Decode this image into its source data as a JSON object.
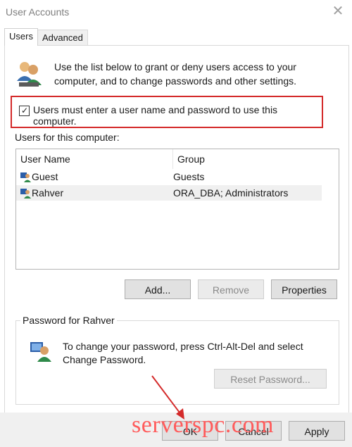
{
  "window": {
    "title": "User Accounts"
  },
  "tabs": [
    {
      "label": "Users",
      "active": true
    },
    {
      "label": "Advanced",
      "active": false
    }
  ],
  "intro": {
    "text": "Use the list below to grant or deny users access to your computer, and to change passwords and other settings.",
    "icon": "users-icon"
  },
  "require_login": {
    "label": "Users must enter a user name and password to use this computer.",
    "checked": true
  },
  "users_section": {
    "label": "Users for this computer:",
    "columns": [
      "User Name",
      "Group"
    ],
    "rows": [
      {
        "name": "Guest",
        "group": "Guests",
        "selected": false
      },
      {
        "name": "Rahver",
        "group": "ORA_DBA; Administrators",
        "selected": true
      }
    ]
  },
  "buttons": {
    "add": "Add...",
    "remove": "Remove",
    "properties": "Properties"
  },
  "password_group": {
    "title": "Password for Rahver",
    "text": "To change your password, press Ctrl-Alt-Del and select Change Password.",
    "reset_label": "Reset Password..."
  },
  "footer": {
    "ok": "OK",
    "cancel": "Cancel",
    "apply": "Apply"
  },
  "watermark": "serverspc.com",
  "colors": {
    "highlight": "#d42a2a",
    "watermark": "#ff5b5b"
  }
}
